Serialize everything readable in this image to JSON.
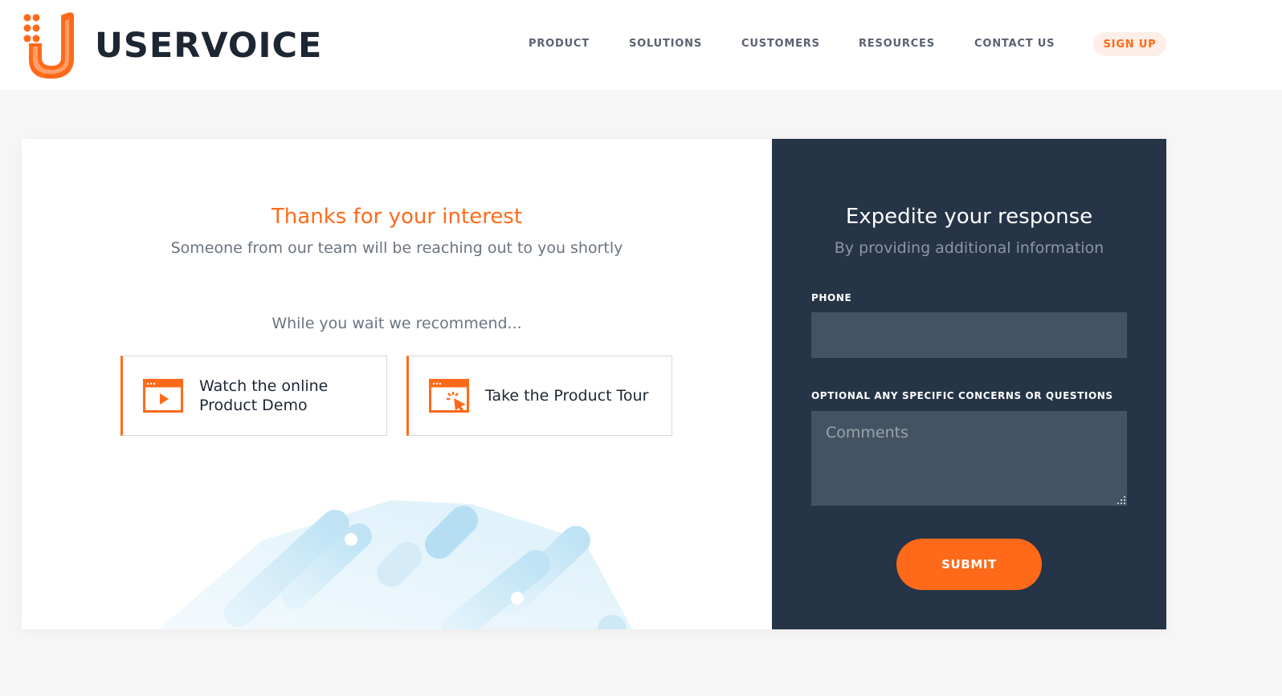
{
  "brand": {
    "name": "USERVOICE",
    "accent": "#ff6a1a",
    "dark_panel": "#253446"
  },
  "nav": {
    "items": [
      "PRODUCT",
      "SOLUTIONS",
      "CUSTOMERS",
      "RESOURCES",
      "CONTACT US"
    ],
    "signup": "SIGN UP"
  },
  "thanks": {
    "title": "Thanks for your interest",
    "subtitle": "Someone from our team will be reaching out to you shortly",
    "recommend_intro": "While you wait we recommend..."
  },
  "recommendations": [
    {
      "label": "Watch the online Product Demo",
      "icon": "video-play-icon"
    },
    {
      "label": "Take the Product Tour",
      "icon": "browser-cursor-click-icon"
    }
  ],
  "form": {
    "title": "Expedite your response",
    "subtitle": "By providing additional information",
    "phone_label": "PHONE",
    "phone_value": "",
    "comments_label": "OPTIONAL ANY SPECIFIC CONCERNS OR QUESTIONS",
    "comments_placeholder": "Comments",
    "submit_label": "SUBMIT"
  }
}
